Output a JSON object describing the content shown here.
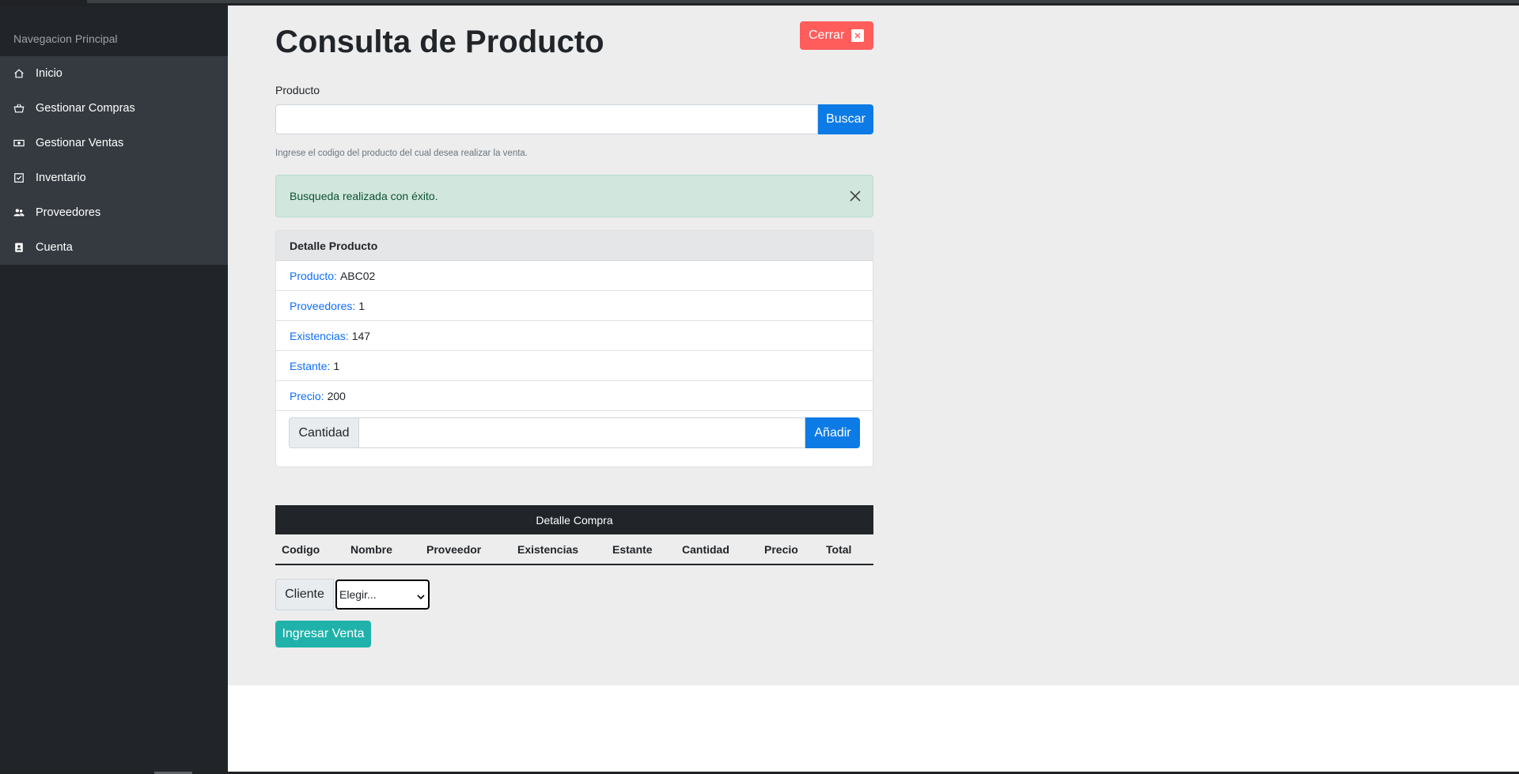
{
  "sidebar": {
    "heading": "Navegacion Principal",
    "items": [
      {
        "label": "Inicio",
        "icon": "home-icon"
      },
      {
        "label": "Gestionar Compras",
        "icon": "basket-icon"
      },
      {
        "label": "Gestionar Ventas",
        "icon": "cash-icon"
      },
      {
        "label": "Inventario",
        "icon": "checklist-icon"
      },
      {
        "label": "Proveedores",
        "icon": "users-icon"
      },
      {
        "label": "Cuenta",
        "icon": "contact-card-icon"
      }
    ]
  },
  "page": {
    "title": "Consulta de Producto",
    "close_label": "Cerrar"
  },
  "search": {
    "label": "Producto",
    "value": "",
    "button": "Buscar",
    "help": "Ingrese el codigo del producto del cual desea realizar la venta."
  },
  "alert": {
    "message": "Busqueda realizada con éxito."
  },
  "detail": {
    "header": "Detalle Producto",
    "rows": [
      {
        "key": "Producto:",
        "value": "ABC02"
      },
      {
        "key": "Proveedores:",
        "value": "1"
      },
      {
        "key": "Existencias:",
        "value": "147"
      },
      {
        "key": "Estante:",
        "value": "1"
      },
      {
        "key": "Precio:",
        "value": "200"
      }
    ],
    "quantity_label": "Cantidad",
    "quantity_value": "",
    "add_button": "Añadir"
  },
  "purchase_table": {
    "caption": "Detalle Compra",
    "columns": [
      "Codigo",
      "Nombre",
      "Proveedor",
      "Existencias",
      "Estante",
      "Cantidad",
      "Precio",
      "Total"
    ]
  },
  "client": {
    "label": "Cliente",
    "selected": "Elegir..."
  },
  "submit_button": "Ingresar Venta",
  "colors": {
    "sidebar": "#212529",
    "menu": "#343a40",
    "primary": "#0d7be6",
    "danger": "#ff5c5c",
    "success_bg": "#d1e7dd",
    "teal": "#20b2aa"
  }
}
